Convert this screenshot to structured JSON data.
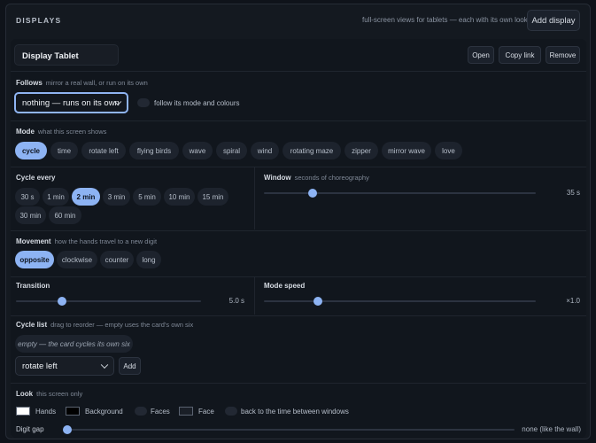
{
  "header": {
    "title": "DISPLAYS",
    "hint": "full-screen views for tablets — each with its own look",
    "add_button": "Add display"
  },
  "display": {
    "name": "Display Tablet",
    "open": "Open",
    "copy_link": "Copy link",
    "remove": "Remove"
  },
  "follows": {
    "label": "Follows",
    "hint": "mirror a real wall, or run on its own",
    "selected": "nothing — runs on its own",
    "toggle_label": "follow its mode and colours"
  },
  "mode": {
    "label": "Mode",
    "hint": "what this screen shows",
    "chips": [
      "cycle",
      "time",
      "rotate left",
      "flying birds",
      "wave",
      "spiral",
      "wind",
      "rotating maze",
      "zipper",
      "mirror wave",
      "love"
    ],
    "active": "cycle"
  },
  "cycle_every": {
    "label": "Cycle every",
    "chips": [
      "30 s",
      "1 min",
      "2 min",
      "3 min",
      "5 min",
      "10 min",
      "15 min",
      "30 min",
      "60 min"
    ],
    "active": "2 min"
  },
  "window": {
    "label": "Window",
    "hint": "seconds of choreography",
    "value": "35 s",
    "level": 0.18
  },
  "movement": {
    "label": "Movement",
    "hint": "how the hands travel to a new digit",
    "chips": [
      "opposite",
      "clockwise",
      "counter",
      "long"
    ],
    "active": "opposite"
  },
  "transition": {
    "label": "Transition",
    "value": "5.0 s",
    "level": 0.25
  },
  "mode_speed": {
    "label": "Mode speed",
    "value": "×1.0",
    "level": 0.2
  },
  "cycle_list": {
    "label": "Cycle list",
    "hint": "drag to reorder — empty uses the card's own six",
    "empty_text": "empty — the card cycles its own six",
    "selected": "rotate left",
    "add": "Add"
  },
  "look": {
    "label": "Look",
    "hint": "this screen only",
    "hands": "Hands",
    "background": "Background",
    "faces": "Faces",
    "face": "Face",
    "back_to_time": "back to the time between windows",
    "hands_color": "#ffffff",
    "background_color": "#000000",
    "face_color": "#1a1f27"
  },
  "digit_gap": {
    "label": "Digit gap",
    "value": "none (like the wall)",
    "level": 0.0
  },
  "colors": {
    "accent": "#8db3f3"
  }
}
